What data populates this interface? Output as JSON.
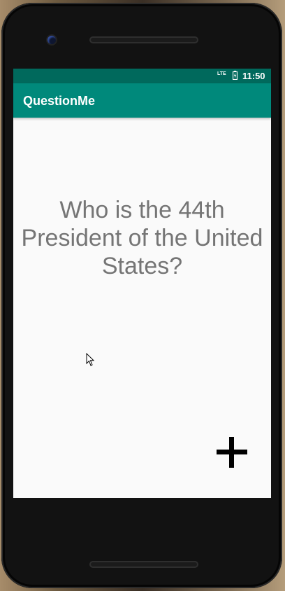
{
  "status_bar": {
    "network": "LTE",
    "battery_icon": "battery-charging-icon",
    "time": "11:50"
  },
  "app_bar": {
    "title": "QuestionMe"
  },
  "main": {
    "question": "Who is the 44th President of the United States?",
    "add_icon": "plus-icon"
  },
  "colors": {
    "status_bar": "#00695c",
    "app_bar": "#00897b",
    "background": "#fafafa",
    "question_text": "#757575"
  }
}
